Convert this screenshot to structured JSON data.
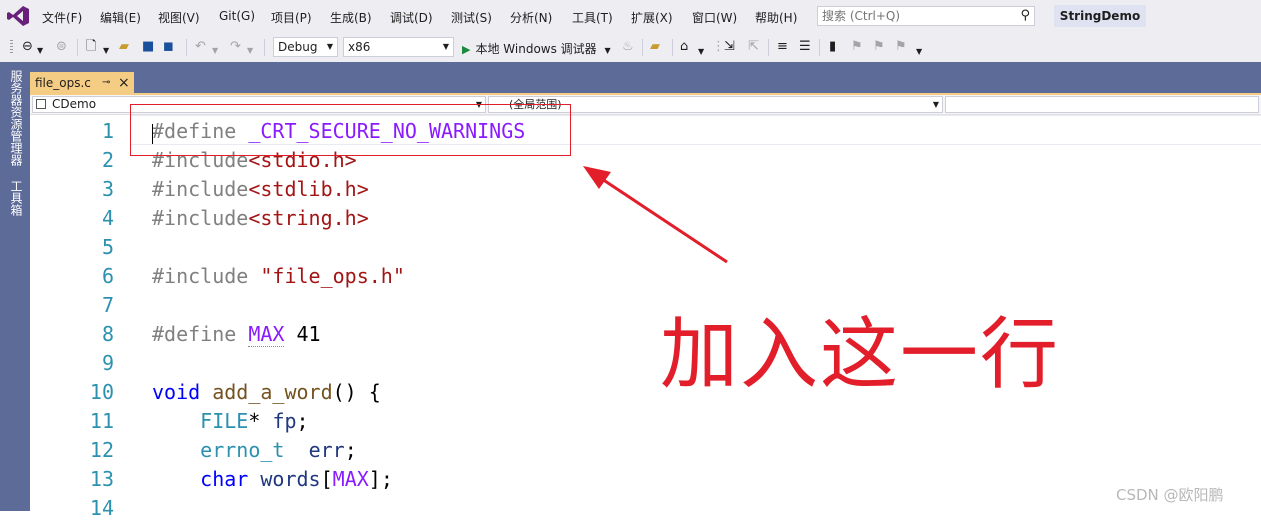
{
  "menu": [
    "文件(F)",
    "编辑(E)",
    "视图(V)",
    "Git(G)",
    "项目(P)",
    "生成(B)",
    "调试(D)",
    "测试(S)",
    "分析(N)",
    "工具(T)",
    "扩展(X)",
    "窗口(W)",
    "帮助(H)"
  ],
  "search": {
    "placeholder": "搜索 (Ctrl+Q)"
  },
  "solution_name": "StringDemo",
  "toolbar": {
    "config": "Debug",
    "platform": "x86",
    "run_label": "本地 Windows 调试器"
  },
  "left_rail": {
    "server_explorer": "服务器资源管理器",
    "toolbox": "工具箱"
  },
  "document_tab": {
    "label": "file_ops.c"
  },
  "navbar": {
    "project": "CDemo",
    "scope": "(全局范围)"
  },
  "code": {
    "line_numbers": [
      "1",
      "2",
      "3",
      "4",
      "5",
      "6",
      "7",
      "8",
      "9",
      "10",
      "11",
      "12",
      "13",
      "14"
    ],
    "l1": {
      "pp": "#define",
      "mac": "_CRT_SECURE_NO_WARNINGS"
    },
    "l2": {
      "pp": "#include",
      "str": "<stdio.h>"
    },
    "l3": {
      "pp": "#include",
      "str": "<stdlib.h>"
    },
    "l4": {
      "pp": "#include",
      "str": "<string.h>"
    },
    "l6": {
      "pp": "#include",
      "str": "\"file_ops.h\""
    },
    "l8": {
      "pp": "#define",
      "mac": "MAX",
      "val": "41"
    },
    "l10": {
      "kw": "void",
      "fn": "add_a_word",
      "rest": "() {"
    },
    "l11": {
      "ty": "FILE",
      "star": "*",
      "id": "fp",
      "semi": ";"
    },
    "l12": {
      "ty": "errno_t",
      "id": "err",
      "semi": ";"
    },
    "l13": {
      "kw": "char",
      "id": "words",
      "open": "[",
      "mac": "MAX",
      "close": "];"
    }
  },
  "annotation": {
    "text": "加入这一行",
    "color": "#e21e2b"
  },
  "watermark": "CSDN @欧阳鹏",
  "colors": {
    "accent_tab": "#f5cc84",
    "dock": "#5d6b99",
    "line_number": "#2b91af"
  }
}
